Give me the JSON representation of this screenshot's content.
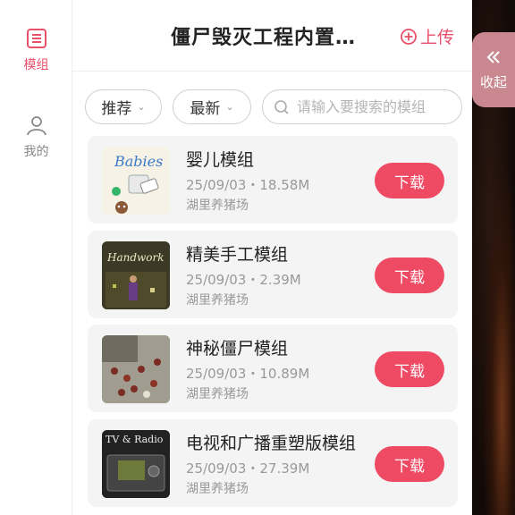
{
  "rail": {
    "mods_label": "模组",
    "mine_label": "我的"
  },
  "header": {
    "title": "僵尸毁灭工程内置…",
    "upload_label": "上传"
  },
  "filters": {
    "sort_label": "推荐",
    "time_label": "最新",
    "search_placeholder": "请输入要搜索的模组"
  },
  "mods": [
    {
      "title": "婴儿模组",
      "date": "25/09/03",
      "size": "18.58M",
      "author": "湖里养猪场",
      "download_label": "下载",
      "thumb_text": "Babies"
    },
    {
      "title": "精美手工模组",
      "date": "25/09/03",
      "size": "2.39M",
      "author": "湖里养猪场",
      "download_label": "下载",
      "thumb_text": "Handwork"
    },
    {
      "title": "神秘僵尸模组",
      "date": "25/09/03",
      "size": "10.89M",
      "author": "湖里养猪场",
      "download_label": "下载",
      "thumb_text": ""
    },
    {
      "title": "电视和广播重塑版模组",
      "date": "25/09/03",
      "size": "27.39M",
      "author": "湖里养猪场",
      "download_label": "下载",
      "thumb_text": "TV & Radio"
    }
  ],
  "meta_separator": "・",
  "collapse": {
    "label": "收起"
  },
  "colors": {
    "accent": "#ef4a64",
    "card_bg": "#f4f4f4"
  }
}
